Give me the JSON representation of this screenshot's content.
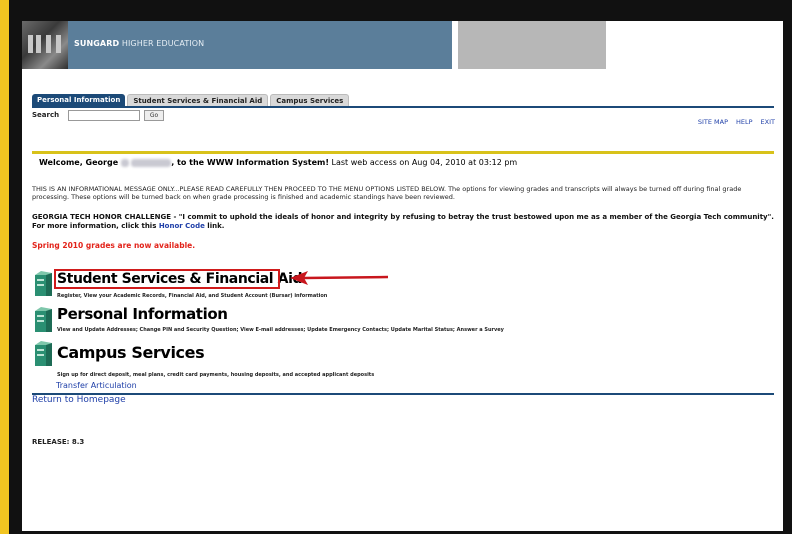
{
  "header": {
    "brand_bold": "SUNGARD",
    "brand_light": " HIGHER EDUCATION"
  },
  "tabs": [
    {
      "label": "Personal Information",
      "active": true
    },
    {
      "label": "Student Services & Financial Aid",
      "active": false
    },
    {
      "label": "Campus Services",
      "active": false
    }
  ],
  "search": {
    "label": "Search",
    "value": "",
    "button": "Go"
  },
  "toplinks": [
    "SITE MAP",
    "HELP",
    "EXIT"
  ],
  "welcome": {
    "prefix": "Welcome, George",
    "middle": ", to the WWW Information System!",
    "suffix": " Last web access on Aug 04, 2010 at 03:12 pm"
  },
  "info_message": "THIS IS AN INFORMATIONAL MESSAGE ONLY...PLEASE READ CAREFULLY THEN PROCEED TO THE MENU OPTIONS LISTED BELOW. The options for viewing grades and transcripts will always be turned off during final grade processing. These options will be turned back on when grade processing is finished and academic standings have been reviewed.",
  "honor": {
    "text": "GEORGIA TECH HONOR CHALLENGE - \"I commit to uphold the ideals of honor and integrity by refusing to betray the trust bestowed upon me as a member of the Georgia Tech community\". For more information, click this ",
    "link": "Honor Code",
    "after": " link."
  },
  "notice": "Spring 2010 grades are now available.",
  "menu": [
    {
      "title": "Student Services & Financial Aid",
      "desc": "Register, View your Academic Records, Financial Aid, and Student Account (Bursar) information"
    },
    {
      "title": "Personal Information",
      "desc": "View and Update Addresses; Change PIN and Security Question; View E-mail addresses; Update Emergency Contacts; Update Marital Status; Answer a Survey"
    },
    {
      "title": "Campus Services",
      "desc": "Sign up for direct deposit, meal plans, credit card payments, housing deposits, and accepted applicant deposits"
    }
  ],
  "transfer_link": "Transfer Articulation",
  "homepage_link": "Return to Homepage",
  "release": "RELEASE: 8.3",
  "colors": {
    "outer_border": "#f2c521",
    "nav_blue": "#1c4a78",
    "link_blue": "#1f3fa8",
    "alert_red": "#e2231a",
    "highlight_red": "#d01b1b"
  }
}
